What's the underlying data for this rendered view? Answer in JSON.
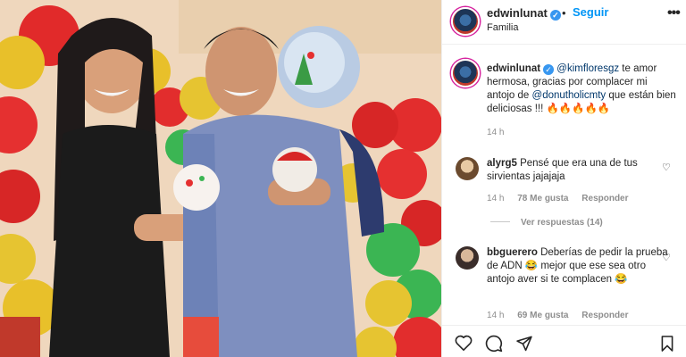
{
  "post": {
    "username": "edwinlunat",
    "follow_label": "Seguir",
    "location": "Familia",
    "caption_mention_1": "@kimfloresgz",
    "caption_text_1": " te amor hermosa, gracias por complacer mi antojo de ",
    "caption_mention_2": "@donutholicmty",
    "caption_text_2": " que están bien deliciosas !!! ",
    "caption_emoji": "🔥🔥🔥🔥🔥",
    "time": "14 h"
  },
  "comments": [
    {
      "username": "alyrg5",
      "text": "Pensé que era una de tus sirvientas jajajaja",
      "time": "14 h",
      "likes": "78 Me gusta",
      "reply_label": "Responder"
    },
    {
      "username": "bbguerero",
      "text": "Deberías de pedir la prueba de ADN 😂 mejor que ese sea otro antojo aver si te complacen 😂",
      "time": "14 h",
      "likes": "69 Me gusta",
      "reply_label": "Responder"
    }
  ],
  "view_replies": "Ver respuestas (14)",
  "colors": {
    "link": "#0095f6",
    "mention": "#00376b",
    "muted": "#8e8e8e",
    "border": "#efefef"
  },
  "icons": [
    "verified-icon",
    "more-options-icon",
    "heart-icon",
    "comment-icon",
    "share-icon",
    "bookmark-icon"
  ]
}
